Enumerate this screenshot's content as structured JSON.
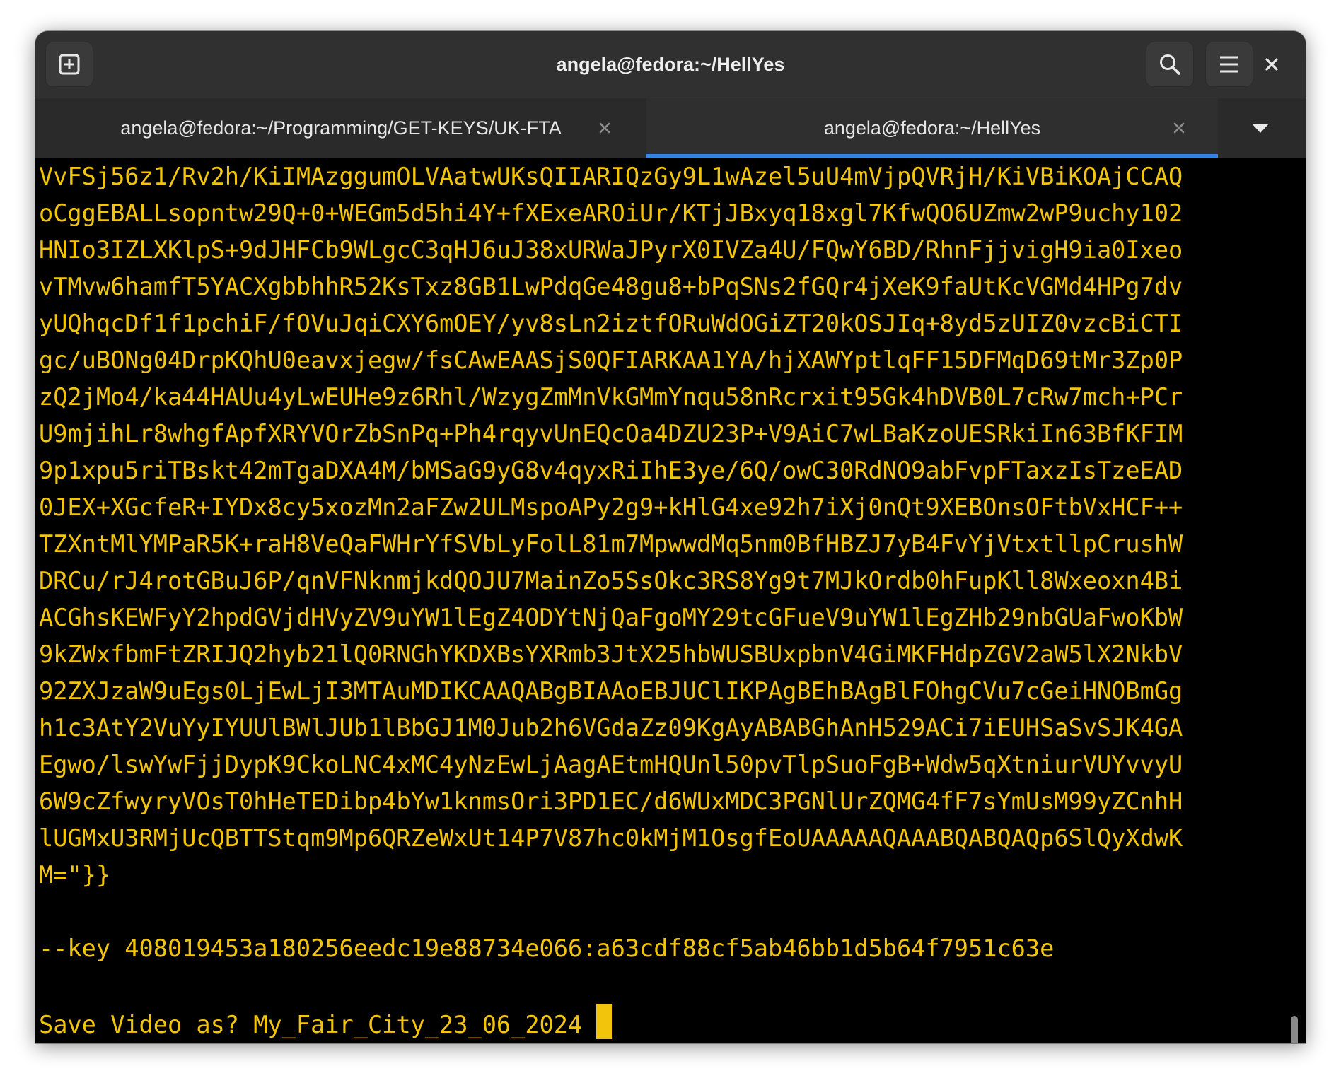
{
  "window": {
    "title": "angela@fedora:~/HellYes"
  },
  "tabs": [
    {
      "label": "angela@fedora:~/Programming/GET-KEYS/UK-FTA",
      "active": false
    },
    {
      "label": "angela@fedora:~/HellYes",
      "active": true
    }
  ],
  "icons": {
    "new_tab": "new-tab-icon",
    "search": "search-icon",
    "menu": "hamburger-menu-icon",
    "close": "close-icon",
    "tab_close": "close-icon",
    "tab_list": "chevron-down-icon"
  },
  "colors": {
    "terminal_text": "#f2c40c",
    "terminal_background": "#000000",
    "active_tab_indicator": "#3584e4"
  },
  "terminal": {
    "lines": [
      "VvFSj56z1/Rv2h/KiIMAzggumOLVAatwUKsQIIARIQzGy9L1wAzel5uU4mVjpQVRjH/KiVBiKOAjCCAQ",
      "oCggEBALLsopntw29Q+0+WEGm5d5hi4Y+fXExeAROiUr/KTjJBxyq18xgl7KfwQO6UZmw2wP9uchy102",
      "HNIo3IZLXKlpS+9dJHFCb9WLgcC3qHJ6uJ38xURWaJPyrX0IVZa4U/FQwY6BD/RhnFjjvigH9ia0Ixeo",
      "vTMvw6hamfT5YACXgbbhhR52KsTxz8GB1LwPdqGe48gu8+bPqSNs2fGQr4jXeK9faUtKcVGMd4HPg7dv",
      "yUQhqcDf1f1pchiF/fOVuJqiCXY6mOEY/yv8sLn2iztfORuWdOGiZT20kOSJIq+8yd5zUIZ0vzcBiCTI",
      "gc/uBONg04DrpKQhU0eavxjegw/fsCAwEAASjS0QFIARKAA1YA/hjXAWYptlqFF15DFMqD69tMr3Zp0P",
      "zQ2jMo4/ka44HAUu4yLwEUHe9z6Rhl/WzygZmMnVkGMmYnqu58nRcrxit95Gk4hDVB0L7cRw7mch+PCr",
      "U9mjihLr8whgfApfXRYVOrZbSnPq+Ph4rqyvUnEQcOa4DZU23P+V9AiC7wLBaKzoUESRkiIn63BfKFIM",
      "9p1xpu5riTBskt42mTgaDXA4M/bMSaG9yG8v4qyxRiIhE3ye/6Q/owC30RdNO9abFvpFTaxzIsTzeEAD",
      "0JEX+XGcfeR+IYDx8cy5xozMn2aFZw2ULMspoAPy2g9+kHlG4xe92h7iXj0nQt9XEBOnsOFtbVxHCF++",
      "TZXntMlYMPaR5K+raH8VeQaFWHrYfSVbLyFolL81m7MpwwdMq5nm0BfHBZJ7yB4FvYjVtxtllpCrushW",
      "DRCu/rJ4rotGBuJ6P/qnVFNknmjkdQOJU7MainZo5SsOkc3RS8Yg9t7MJkOrdb0hFupKll8Wxeoxn4Bi",
      "ACGhsKEWFyY2hpdGVjdHVyZV9uYW1lEgZ4ODYtNjQaFgoMY29tcGFueV9uYW1lEgZHb29nbGUaFwoKbW",
      "9kZWxfbmFtZRIJQ2hyb21lQ0RNGhYKDXBsYXRmb3JtX25hbWUSBUxpbnV4GiMKFHdpZGV2aW5lX2NkbV",
      "92ZXJzaW9uEgs0LjEwLjI3MTAuMDIKCAAQABgBIAAoEBJUClIKPAgBEhBAgBlFOhgCVu7cGeiHNOBmGg",
      "h1c3AtY2VuYyIYUUlBWlJUb1lBbGJ1M0Jub2h6VGdaZz09KgAyABABGhAnH529ACi7iEUHSaSvSJK4GA",
      "Egwo/lswYwFjjDypK9CkoLNC4xMC4yNzEwLjAagAEtmHQUnl50pvTlpSuoFgB+Wdw5qXtniurVUYvvyU",
      "6W9cZfwyryVOsT0hHeTEDibp4bYw1knmsOri3PD1EC/d6WUxMDC3PGNlUrZQMG4fF7sYmUsM99yZCnhH",
      "lUGMxU3RMjUcQBTTStqm9Mp6QRZeWxUt14P7V87hc0kMjM1OsgfEoUAAAAAQAAABQABQAQp6SlQyXdwK",
      "M=\"}}",
      "",
      "--key 408019453a180256eedc19e88734e066:a63cdf88cf5ab46bb1d5b64f7951c63e",
      ""
    ],
    "prompt": "Save Video as? My_Fair_City_23_06_2024 "
  }
}
